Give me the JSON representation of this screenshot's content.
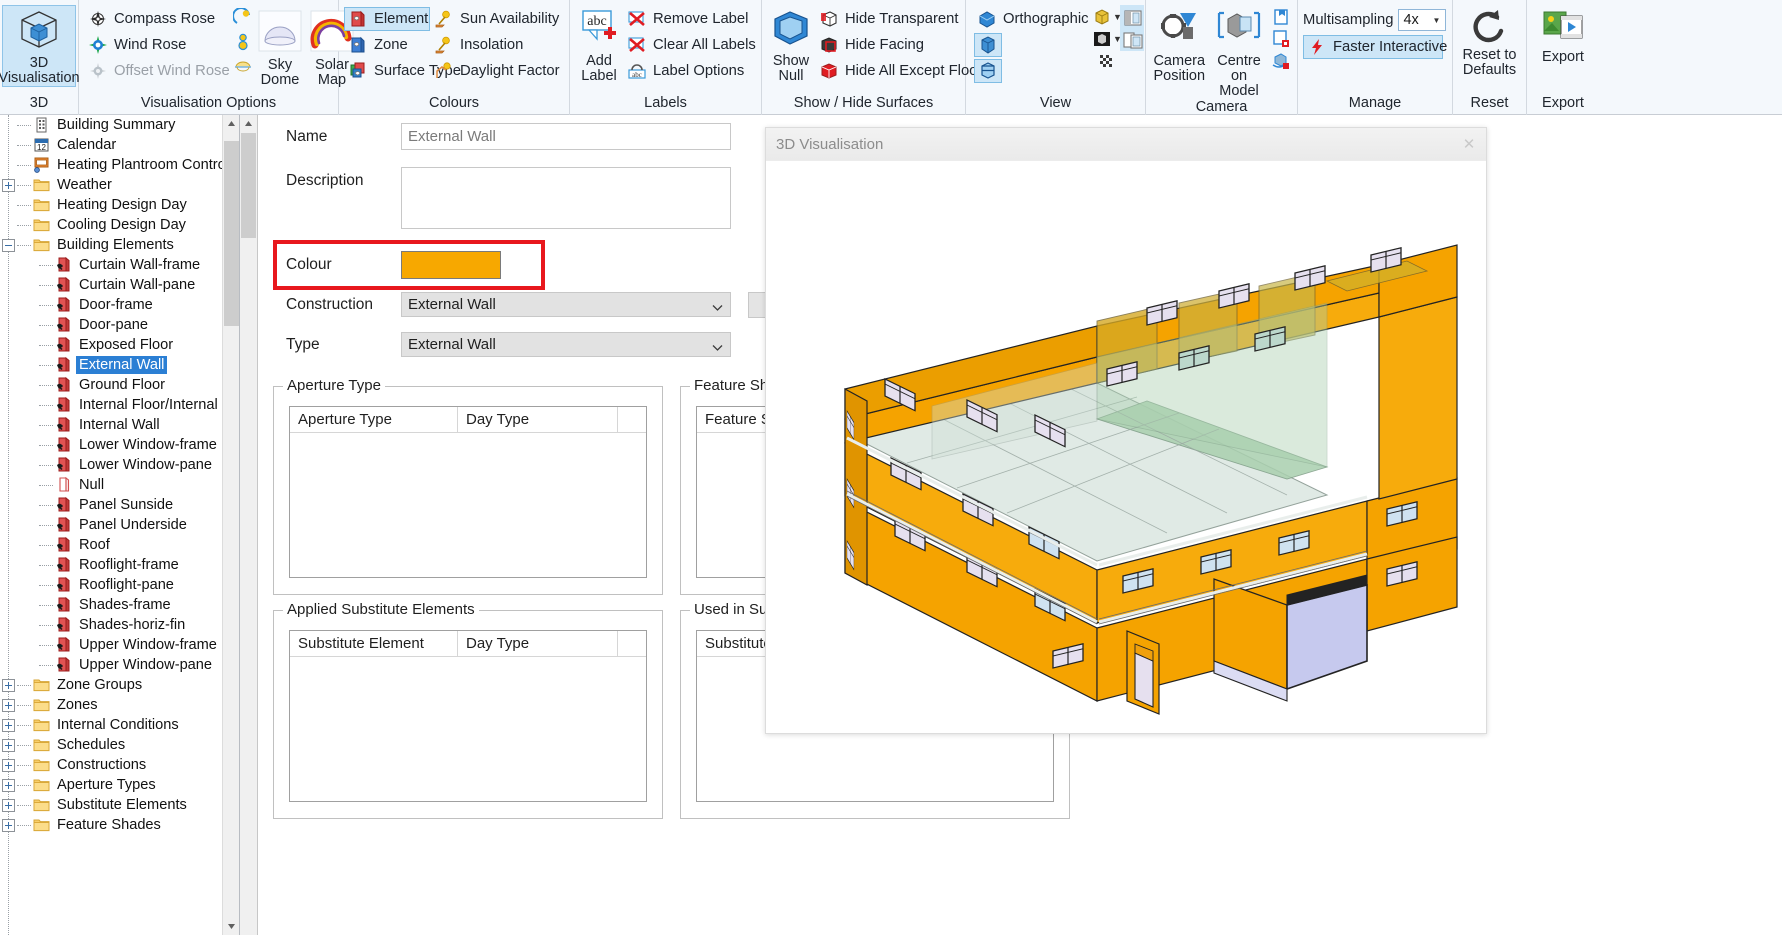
{
  "ribbon": {
    "groups": [
      {
        "title": "3D",
        "items": [
          {
            "label": "3D\nVisualisation",
            "icon": "cube-3d-icon",
            "selected": true
          }
        ]
      },
      {
        "title": "Visualisation Options",
        "small": [
          {
            "label": "Compass Rose",
            "icon": "compass-rose-icon",
            "disabled": false
          },
          {
            "label": "Wind Rose",
            "icon": "wind-rose-icon",
            "disabled": false
          },
          {
            "label": "Offset Wind Rose",
            "icon": "offset-wind-rose-icon",
            "disabled": true
          }
        ],
        "mini": [
          {
            "icon": "sun-path-icon"
          },
          {
            "icon": "analemma-icon"
          },
          {
            "icon": "horizon-icon"
          }
        ],
        "big": [
          {
            "label": "Sky\nDome",
            "icon": "sky-dome-icon"
          },
          {
            "label": "Solar\nMap",
            "icon": "solar-map-icon"
          }
        ]
      },
      {
        "title": "Colours",
        "colA": [
          {
            "label": "Element",
            "icon": "element-colour-icon",
            "selected": true
          },
          {
            "label": "Zone",
            "icon": "zone-colour-icon",
            "selected": false
          },
          {
            "label": "Surface Type",
            "icon": "surface-type-icon",
            "selected": false
          }
        ],
        "colB": [
          {
            "label": "Sun Availability",
            "icon": "sun-availability-icon"
          },
          {
            "label": "Insolation",
            "icon": "insolation-icon"
          },
          {
            "label": "Daylight Factor",
            "icon": "daylight-factor-icon"
          }
        ]
      },
      {
        "title": "Labels",
        "big": [
          {
            "label": "Add\nLabel",
            "icon": "add-label-icon"
          }
        ],
        "small": [
          {
            "label": "Remove Label",
            "icon": "remove-label-icon"
          },
          {
            "label": "Clear All Labels",
            "icon": "clear-all-labels-icon"
          },
          {
            "label": "Label Options",
            "icon": "label-options-icon"
          }
        ]
      },
      {
        "title": "Show / Hide Surfaces",
        "big": [
          {
            "label": "Show\nNull",
            "icon": "show-null-icon"
          }
        ],
        "small": [
          {
            "label": "Hide Transparent",
            "icon": "hide-transparent-icon"
          },
          {
            "label": "Hide Facing",
            "icon": "hide-facing-icon"
          },
          {
            "label": "Hide All Except Floors",
            "icon": "hide-all-except-floors-icon"
          }
        ]
      },
      {
        "title": "View",
        "projection_label": "Orthographic",
        "items": [
          {
            "icon": "orthographic-icon",
            "selected": false
          },
          {
            "icon": "solid-view-icon",
            "selected": true
          },
          {
            "icon": "wireframe-view-icon",
            "selected": true
          },
          {
            "icon": "gold-shading-icon",
            "selected": false
          },
          {
            "icon": "dark-shading-icon",
            "selected": false
          },
          {
            "icon": "checker-transparency-icon",
            "selected": false
          },
          {
            "icon": "split-view-single-icon",
            "selected": true
          },
          {
            "icon": "split-view-double-icon",
            "selected": true
          }
        ]
      },
      {
        "title": "Camera",
        "big": [
          {
            "label": "Camera\nPosition",
            "icon": "camera-position-icon"
          },
          {
            "label": "Centre\non Model",
            "icon": "centre-on-model-icon",
            "selected": true
          }
        ],
        "mini": [
          {
            "icon": "save-view-icon"
          },
          {
            "icon": "lock-view-icon"
          },
          {
            "icon": "reset-rotation-lock-icon"
          }
        ]
      },
      {
        "title": "Manage",
        "multisampling_label": "Multisampling",
        "multisampling_value": "4x",
        "faster_interactive_label": "Faster Interactive",
        "faster_interactive_selected": true
      },
      {
        "title": "Reset",
        "big": [
          {
            "label": "Reset to\nDefaults",
            "icon": "reset-to-defaults-icon"
          }
        ]
      },
      {
        "title": "Export",
        "big": [
          {
            "label": "Export",
            "icon": "export-icon"
          }
        ]
      }
    ]
  },
  "sidebar": {
    "nodes": [
      {
        "label": "Building Summary",
        "depth": 0,
        "icon": "building-summary-icon",
        "expander": "none"
      },
      {
        "label": "Calendar",
        "depth": 0,
        "icon": "calendar-icon",
        "expander": "none"
      },
      {
        "label": "Heating Plantroom Controls",
        "depth": 0,
        "icon": "plantroom-icon",
        "expander": "none"
      },
      {
        "label": "Weather",
        "depth": 0,
        "icon": "folder-icon",
        "expander": "plus"
      },
      {
        "label": "Heating Design Day",
        "depth": 0,
        "icon": "folder-icon",
        "expander": "none"
      },
      {
        "label": "Cooling Design Day",
        "depth": 0,
        "icon": "folder-icon",
        "expander": "none"
      },
      {
        "label": "Building Elements",
        "depth": 0,
        "icon": "folder-icon",
        "expander": "minus"
      },
      {
        "label": "Curtain Wall-frame",
        "depth": 1,
        "icon": "element-icon",
        "expander": "none"
      },
      {
        "label": "Curtain Wall-pane",
        "depth": 1,
        "icon": "element-icon",
        "expander": "none"
      },
      {
        "label": "Door-frame",
        "depth": 1,
        "icon": "element-icon",
        "expander": "none"
      },
      {
        "label": "Door-pane",
        "depth": 1,
        "icon": "element-icon",
        "expander": "none"
      },
      {
        "label": "Exposed Floor",
        "depth": 1,
        "icon": "element-icon",
        "expander": "none"
      },
      {
        "label": "External Wall",
        "depth": 1,
        "icon": "element-icon",
        "expander": "none",
        "selected": true
      },
      {
        "label": "Ground Floor",
        "depth": 1,
        "icon": "element-icon",
        "expander": "none"
      },
      {
        "label": "Internal Floor/Internal Ceiling",
        "depth": 1,
        "icon": "element-icon",
        "expander": "none"
      },
      {
        "label": "Internal Wall",
        "depth": 1,
        "icon": "element-icon",
        "expander": "none"
      },
      {
        "label": "Lower Window-frame",
        "depth": 1,
        "icon": "element-icon",
        "expander": "none"
      },
      {
        "label": "Lower Window-pane",
        "depth": 1,
        "icon": "element-icon",
        "expander": "none"
      },
      {
        "label": "Null",
        "depth": 1,
        "icon": "null-element-icon",
        "expander": "none"
      },
      {
        "label": "Panel Sunside",
        "depth": 1,
        "icon": "element-icon",
        "expander": "none"
      },
      {
        "label": "Panel Underside",
        "depth": 1,
        "icon": "element-icon",
        "expander": "none"
      },
      {
        "label": "Roof",
        "depth": 1,
        "icon": "element-icon",
        "expander": "none"
      },
      {
        "label": "Rooflight-frame",
        "depth": 1,
        "icon": "element-icon",
        "expander": "none"
      },
      {
        "label": "Rooflight-pane",
        "depth": 1,
        "icon": "element-icon",
        "expander": "none"
      },
      {
        "label": "Shades-frame",
        "depth": 1,
        "icon": "element-icon",
        "expander": "none"
      },
      {
        "label": "Shades-horiz-fin",
        "depth": 1,
        "icon": "element-icon",
        "expander": "none"
      },
      {
        "label": "Upper Window-frame",
        "depth": 1,
        "icon": "element-icon",
        "expander": "none"
      },
      {
        "label": "Upper Window-pane",
        "depth": 1,
        "icon": "element-icon",
        "expander": "none"
      },
      {
        "label": "Zone Groups",
        "depth": 0,
        "icon": "folder-icon",
        "expander": "plus"
      },
      {
        "label": "Zones",
        "depth": 0,
        "icon": "folder-icon",
        "expander": "plus"
      },
      {
        "label": "Internal Conditions",
        "depth": 0,
        "icon": "folder-icon",
        "expander": "plus"
      },
      {
        "label": "Schedules",
        "depth": 0,
        "icon": "folder-icon",
        "expander": "plus"
      },
      {
        "label": "Constructions",
        "depth": 0,
        "icon": "folder-icon",
        "expander": "plus"
      },
      {
        "label": "Aperture Types",
        "depth": 0,
        "icon": "folder-icon",
        "expander": "plus"
      },
      {
        "label": "Substitute Elements",
        "depth": 0,
        "icon": "folder-icon",
        "expander": "plus"
      },
      {
        "label": "Feature Shades",
        "depth": 0,
        "icon": "folder-icon",
        "expander": "plus"
      }
    ]
  },
  "form": {
    "name_label": "Name",
    "name_value": "External Wall",
    "description_label": "Description",
    "description_value": "",
    "colour_label": "Colour",
    "colour_value": "#f7a800",
    "construction_label": "Construction",
    "construction_value": "External Wall",
    "type_label": "Type",
    "type_value": "External Wall",
    "groups": [
      {
        "title": "Aperture Type",
        "columns": [
          "Aperture Type",
          "Day Type"
        ],
        "rows": []
      },
      {
        "title": "Feature Shading",
        "columns": [
          "Feature Shade"
        ],
        "rows": []
      },
      {
        "title": "Applied Substitute Elements",
        "columns": [
          "Substitute Element",
          "Day Type"
        ],
        "rows": []
      },
      {
        "title": "Used in Substitute Elements",
        "columns": [
          "Substitute Element"
        ],
        "rows": []
      }
    ]
  },
  "vis3d": {
    "title": "3D Visualisation",
    "close_label": "✕",
    "colors": {
      "wall": "#f5a300",
      "wall_shade": "#e09400",
      "wall_dark": "#c88400",
      "glass_green": "#a9cfae",
      "glass_light": "#dfe9e4",
      "glass_blue": "#c6c9ee",
      "window_pane": "#e6e0ef",
      "window_blue": "#cfe2f0",
      "outline": "#232323"
    }
  }
}
